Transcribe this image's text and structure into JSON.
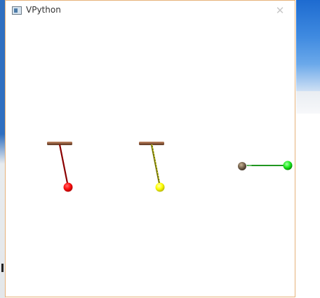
{
  "window": {
    "title": "VPython",
    "close_glyph": "✕"
  },
  "icons": {
    "app": "vpython-app-icon",
    "close": "close-icon"
  },
  "colors": {
    "window_border": "#e6b27a",
    "pendulum_1_bob": "#ff0000",
    "pendulum_1_rod": "#8b0000",
    "pendulum_2_bob": "#ffff00",
    "pendulum_2_rod": "#8b8b00",
    "spring_bob": "#00ee00",
    "spring_rod": "#008800",
    "anchor_ball": "#6b5a45",
    "support_bar": "#8b5a3c"
  }
}
